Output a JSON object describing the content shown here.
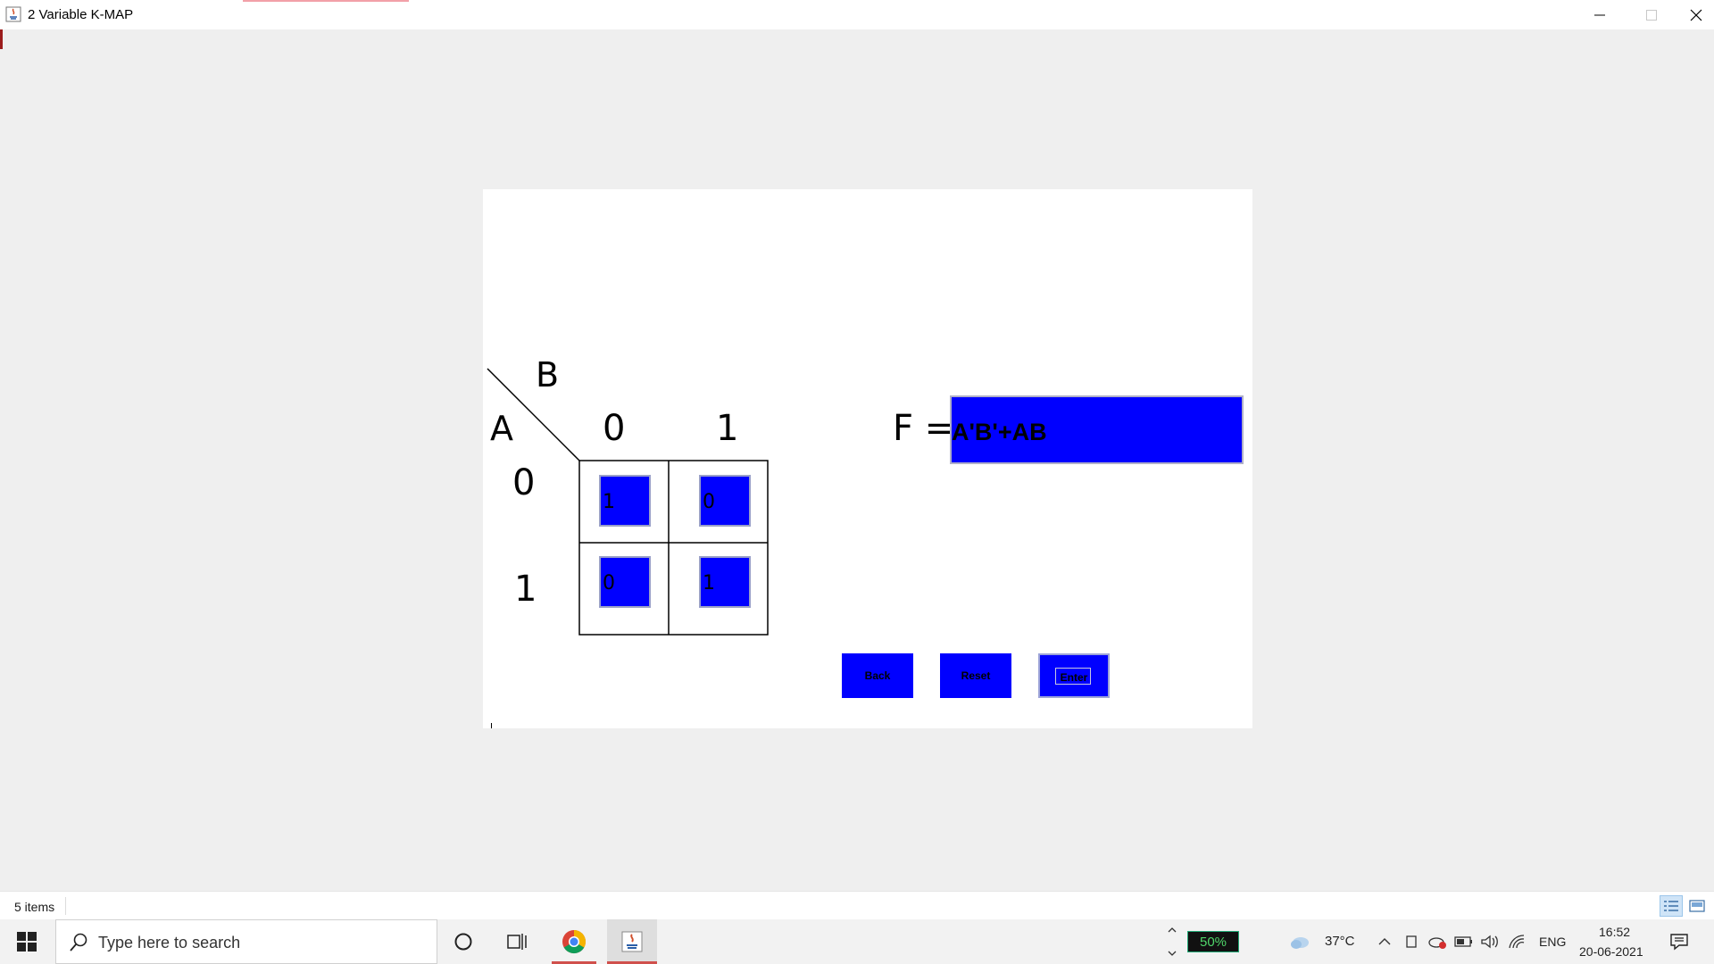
{
  "window": {
    "title": "2 Variable K-MAP"
  },
  "kmap": {
    "var_col": "B",
    "var_row": "A",
    "col_headers": [
      "0",
      "1"
    ],
    "row_headers": [
      "0",
      "1"
    ],
    "cells": [
      [
        "1",
        "0"
      ],
      [
        "0",
        "1"
      ]
    ],
    "function_label": "F =",
    "function_value": "A'B'+AB"
  },
  "buttons": {
    "back": "Back",
    "reset": "Reset",
    "enter": "Enter"
  },
  "status": {
    "items": "5 items"
  },
  "taskbar": {
    "search_placeholder": "Type here to search",
    "battery": "50%",
    "temperature": "37°C",
    "language": "ENG",
    "time": "16:52",
    "date": "20-06-2021"
  },
  "colors": {
    "cell_blue": "#0000ff",
    "panel": "#ffffff",
    "background": "#efefef"
  }
}
